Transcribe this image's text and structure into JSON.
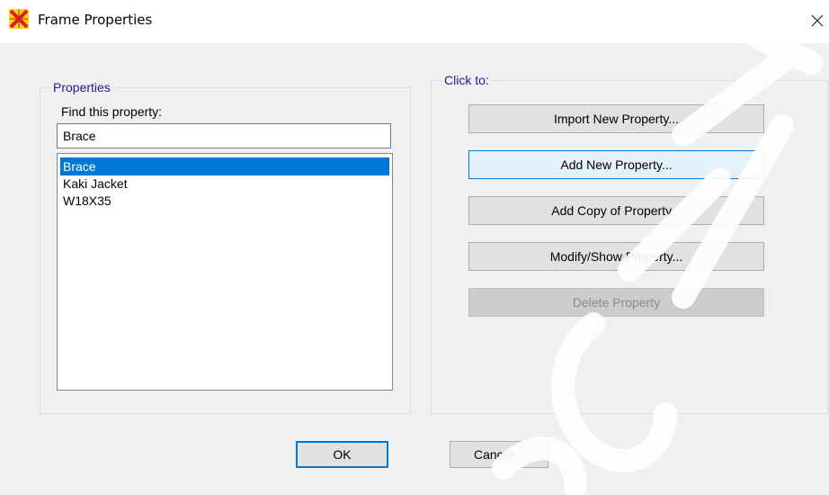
{
  "window": {
    "title": "Frame Properties",
    "app_icon": "sap-x-icon",
    "close_icon": "close-icon"
  },
  "properties": {
    "legend": "Properties",
    "find_label": "Find this property:",
    "search_value": "Brace",
    "items": [
      {
        "label": "Brace",
        "selected": true
      },
      {
        "label": "Kaki Jacket",
        "selected": false
      },
      {
        "label": "W18X35",
        "selected": false
      }
    ]
  },
  "actions": {
    "legend": "Click to:",
    "import_label": "Import New Property...",
    "add_label": "Add New Property...",
    "copy_label": "Add Copy of Property...",
    "modify_label": "Modify/Show Property...",
    "delete_label": "Delete Property"
  },
  "footer": {
    "ok_label": "OK",
    "cancel_label": "Cancel"
  },
  "colors": {
    "selection": "#0078d7",
    "legend_text": "#1a1a99",
    "dialog_bg": "#f0f0f0"
  }
}
